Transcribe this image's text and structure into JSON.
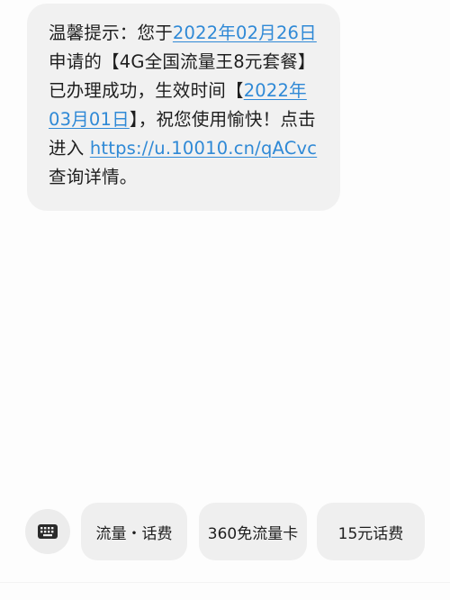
{
  "message": {
    "line1_prefix": "温馨提示：您于",
    "line1_date": "2022年02月26日",
    "line2": "申请的【4G全国流量王8元套餐】",
    "line3_prefix": "已办理成功，生效时间【",
    "line3_date_part1": "2022年",
    "line4_date_part2": "03月01日",
    "line4_suffix": "】，祝您使用愉快！点击",
    "line5_prefix": "进入 ",
    "line5_link": "https://u.10010.cn/qACvc",
    "line6": "查询详情。"
  },
  "quick_replies": [
    {
      "label": "流量・话费"
    },
    {
      "label": "360免流量卡"
    },
    {
      "label": "15元话费"
    }
  ],
  "colors": {
    "link": "#2f89d6",
    "bubble": "#f1f1f1",
    "chip": "#efefef",
    "text": "#1e1e1e"
  }
}
